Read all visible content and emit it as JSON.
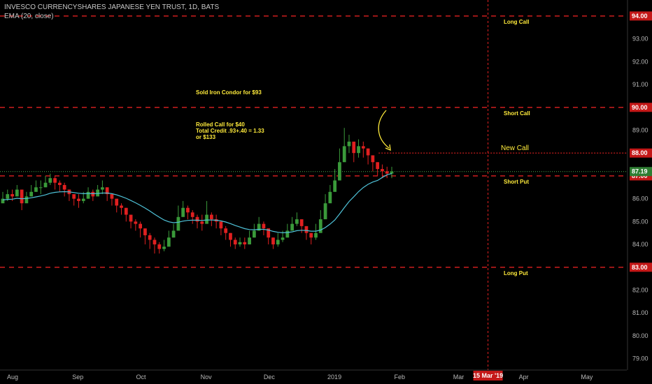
{
  "header": {
    "title": "INVESCO CURRENCYSHARES JAPANESE YEN TRUST, 1D, BATS",
    "indicator": "EMA (20, close)"
  },
  "colors": {
    "background": "#000000",
    "up": "#3a9a3a",
    "down": "#e02020",
    "ema": "#4fc3d9",
    "level": "#e02020",
    "annotation": "#ffeb3b",
    "new_call": "#ffeb3b",
    "last_price": "#4caf50",
    "price_badge": "#c41818"
  },
  "chart_data": {
    "type": "candlestick",
    "ylim": [
      78.5,
      94.7
    ],
    "y_ticks": [
      "79.00",
      "80.00",
      "81.00",
      "82.00",
      "83.00",
      "84.00",
      "85.00",
      "86.00",
      "87.00",
      "88.00",
      "89.00",
      "90.00",
      "91.00",
      "92.00",
      "93.00",
      "94.00"
    ],
    "x_labels": [
      "Aug",
      "Sep",
      "Oct",
      "Nov",
      "Dec",
      "2019",
      "Feb",
      "Mar",
      "Apr",
      "May"
    ],
    "x_label_dates": [
      "2018-08-01",
      "2018-09-01",
      "2018-10-01",
      "2018-11-01",
      "2018-12-01",
      "2019-01-01",
      "2019-02-01",
      "2019-03-01",
      "2019-04-01",
      "2019-05-01"
    ],
    "date_range": [
      "2018-07-26",
      "2019-05-20"
    ],
    "vertical_marker": {
      "date": "2019-03-15",
      "label": "15 Mar '19"
    },
    "levels": [
      {
        "price": 94.0,
        "label": "Long Call",
        "badge": "94.00"
      },
      {
        "price": 90.0,
        "label": "Short Call",
        "badge": "90.00"
      },
      {
        "price": 87.0,
        "label": "Short Put",
        "badge": "87.00"
      },
      {
        "price": 83.0,
        "label": "Long Put",
        "badge": "83.00"
      }
    ],
    "new_call": {
      "price": 88.0,
      "label": "New Call",
      "badge": "88.00",
      "from": "2019-01-22"
    },
    "last_price": {
      "price": 87.19,
      "badge": "87.19"
    },
    "annotations": [
      {
        "text": "Sold Iron Condor for $93"
      },
      {
        "text": "Rolled Call for $40"
      },
      {
        "text": "Total Credit .93+.40 = 1.33"
      },
      {
        "text": "or   $133"
      }
    ],
    "series": [
      {
        "name": "Candles",
        "close": [
          86.0,
          86.2,
          86.1,
          86.4,
          85.8,
          86.1,
          86.3,
          86.5,
          86.5,
          86.7,
          86.9,
          86.7,
          86.6,
          86.4,
          86.2,
          86.0,
          85.9,
          86.0,
          86.3,
          86.1,
          86.4,
          86.5,
          86.2,
          86.0,
          85.7,
          85.6,
          85.3,
          85.0,
          84.9,
          84.7,
          84.4,
          84.2,
          84.0,
          83.8,
          83.9,
          84.3,
          84.6,
          85.2,
          85.6,
          85.4,
          85.2,
          85.0,
          84.9,
          85.3,
          85.1,
          85.0,
          84.7,
          84.5,
          84.2,
          84.0,
          84.1,
          84.0,
          84.3,
          84.6,
          84.9,
          84.7,
          84.3,
          84.0,
          84.2,
          84.3,
          84.6,
          84.9,
          85.1,
          84.8,
          84.5,
          84.3,
          84.5,
          85.1,
          85.8,
          86.3,
          86.8,
          87.6,
          88.3,
          88.5,
          88.0,
          88.3,
          88.2,
          87.9,
          87.6,
          87.3,
          87.2,
          87.1,
          87.19
        ],
        "high": [
          86.3,
          86.4,
          86.4,
          86.6,
          86.2,
          86.3,
          86.6,
          86.8,
          86.8,
          87.0,
          87.1,
          87.0,
          86.8,
          86.7,
          86.4,
          86.2,
          86.2,
          86.3,
          86.5,
          86.4,
          86.6,
          86.8,
          86.5,
          86.2,
          86.0,
          85.8,
          85.6,
          85.3,
          85.1,
          85.0,
          84.7,
          84.5,
          84.3,
          84.1,
          84.2,
          84.6,
          84.9,
          85.7,
          85.9,
          85.7,
          85.5,
          85.3,
          85.3,
          85.9,
          85.4,
          85.3,
          85.0,
          84.8,
          84.5,
          84.3,
          84.3,
          84.3,
          84.6,
          84.9,
          85.2,
          85.0,
          84.6,
          84.3,
          84.5,
          84.6,
          84.9,
          85.2,
          85.4,
          85.1,
          84.8,
          84.5,
          84.9,
          85.5,
          86.2,
          86.6,
          87.3,
          88.2,
          89.1,
          88.8,
          88.4,
          88.6,
          88.5,
          88.2,
          87.9,
          87.6,
          87.5,
          87.4,
          87.4
        ],
        "low": [
          85.8,
          85.9,
          85.9,
          86.1,
          85.5,
          85.9,
          86.1,
          86.3,
          86.2,
          86.5,
          86.6,
          86.4,
          86.3,
          86.1,
          85.9,
          85.7,
          85.6,
          85.8,
          86.0,
          85.9,
          86.2,
          86.2,
          85.9,
          85.7,
          85.4,
          85.3,
          85.0,
          84.7,
          84.6,
          84.3,
          84.0,
          83.8,
          83.6,
          83.6,
          83.7,
          84.0,
          84.3,
          84.9,
          85.3,
          85.1,
          84.9,
          84.7,
          84.6,
          85.0,
          84.8,
          84.7,
          84.4,
          84.2,
          83.9,
          83.8,
          83.9,
          83.8,
          84.0,
          84.3,
          84.6,
          84.4,
          84.0,
          83.8,
          83.9,
          84.1,
          84.3,
          84.6,
          84.8,
          84.5,
          84.2,
          84.0,
          84.2,
          84.8,
          85.4,
          86.0,
          86.5,
          87.3,
          87.9,
          88.0,
          87.6,
          87.8,
          87.8,
          87.5,
          87.2,
          87.0,
          86.9,
          86.9,
          86.9
        ]
      },
      {
        "name": "EMA",
        "values": [
          85.95,
          85.97,
          85.98,
          86.02,
          86.0,
          86.01,
          86.04,
          86.08,
          86.12,
          86.17,
          86.24,
          86.28,
          86.3,
          86.31,
          86.3,
          86.27,
          86.24,
          86.22,
          86.23,
          86.22,
          86.23,
          86.25,
          86.25,
          86.22,
          86.17,
          86.1,
          86.02,
          85.92,
          85.82,
          85.71,
          85.59,
          85.46,
          85.32,
          85.19,
          85.07,
          84.99,
          84.95,
          84.97,
          85.02,
          85.05,
          85.06,
          85.06,
          85.05,
          85.07,
          85.07,
          85.06,
          85.03,
          84.98,
          84.91,
          84.83,
          84.76,
          84.69,
          84.65,
          84.64,
          84.66,
          84.66,
          84.63,
          84.57,
          84.53,
          84.51,
          84.52,
          84.55,
          84.6,
          84.62,
          84.61,
          84.58,
          84.58,
          84.63,
          84.74,
          84.89,
          85.07,
          85.33,
          85.61,
          85.88,
          86.09,
          86.31,
          86.49,
          86.63,
          86.73,
          86.8,
          86.93,
          87.05,
          87.1
        ]
      }
    ]
  }
}
